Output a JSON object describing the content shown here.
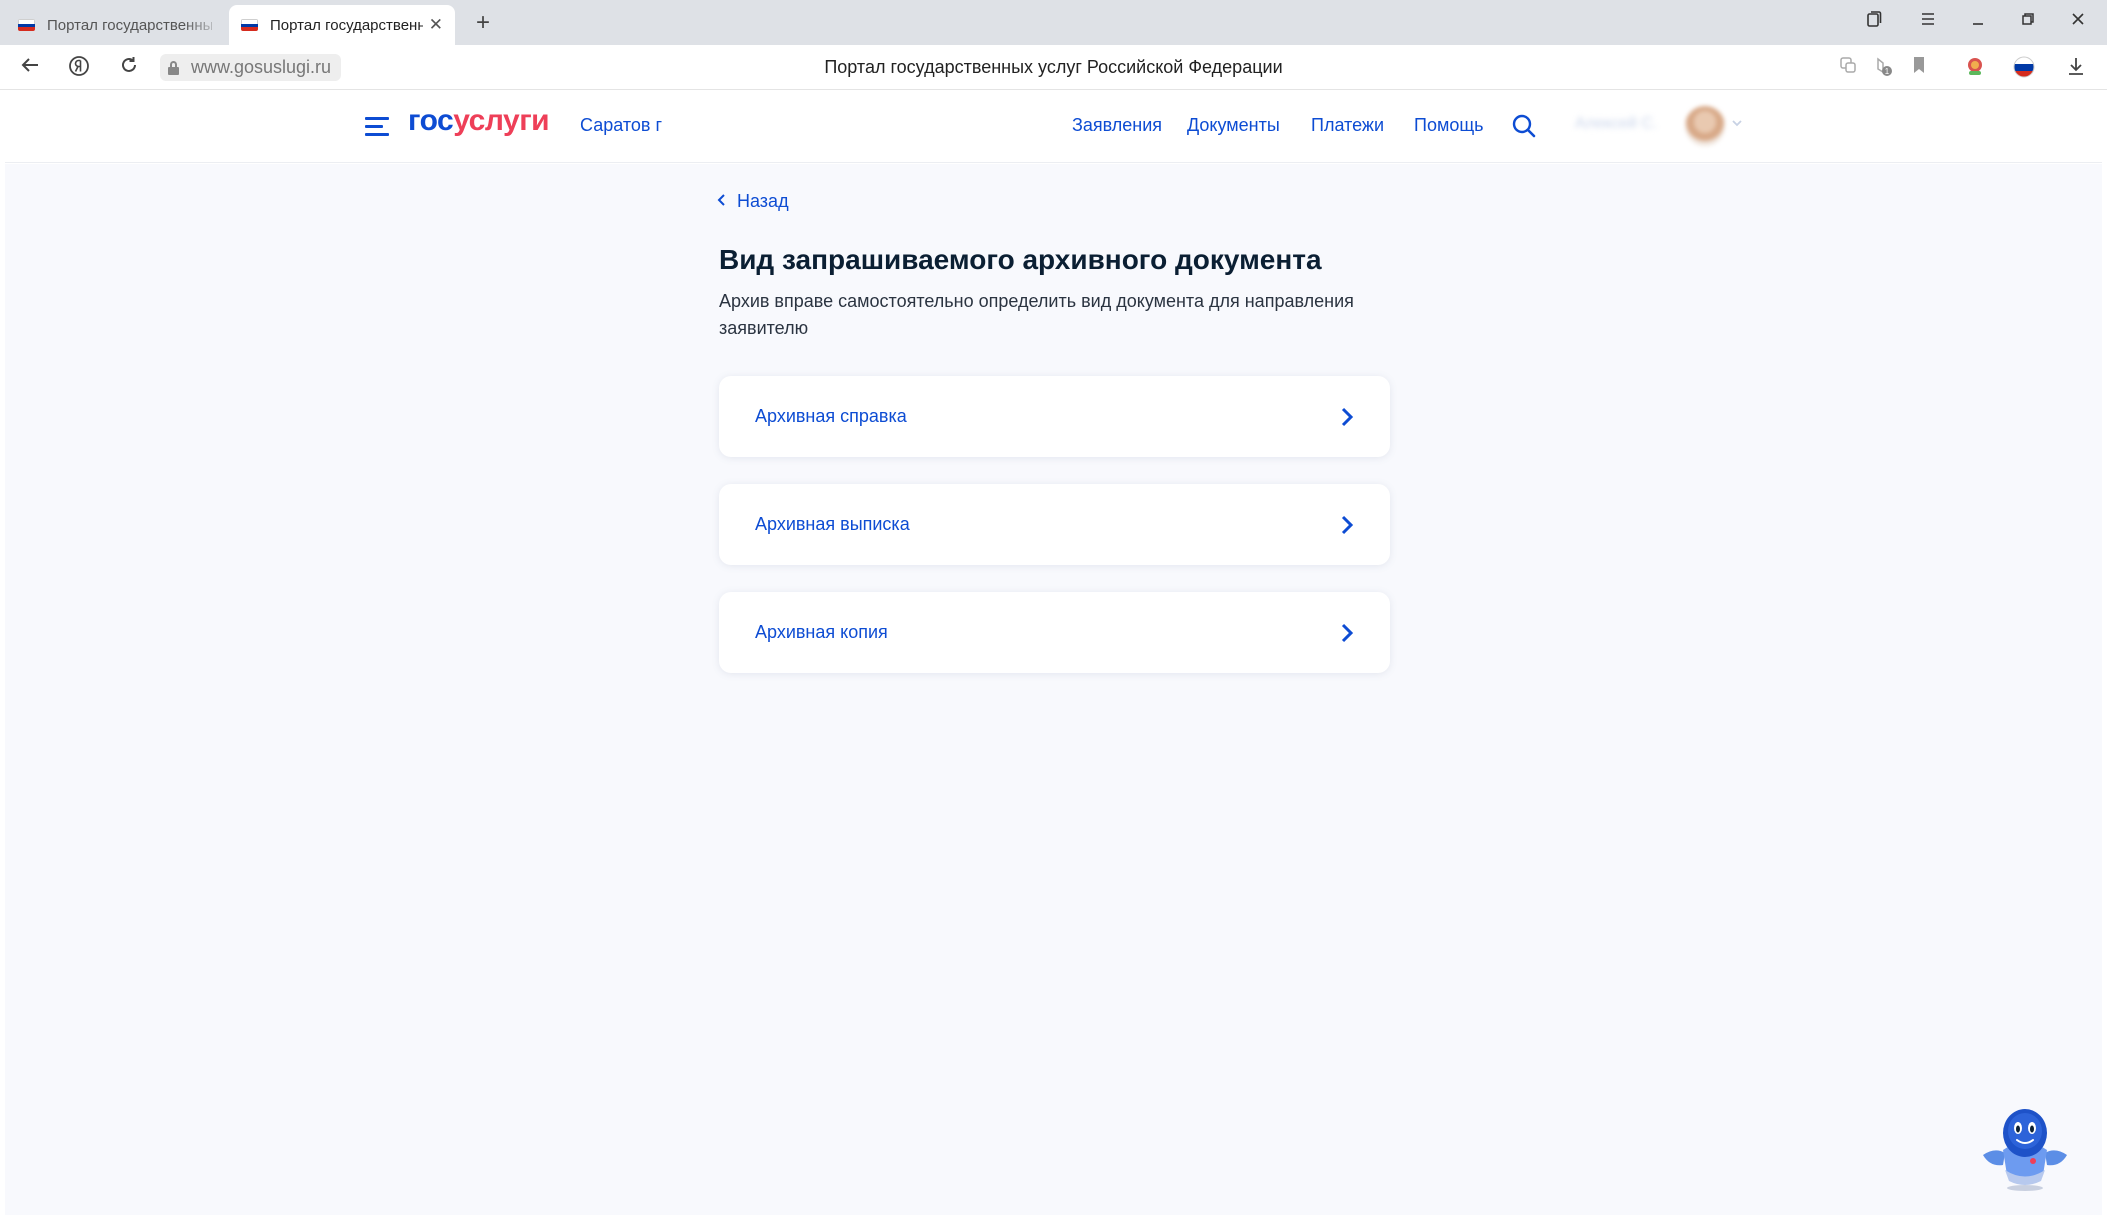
{
  "browser": {
    "tabs": [
      {
        "title": "Портал государственных"
      },
      {
        "title": "Портал государственны",
        "close": "✕"
      }
    ],
    "new_tab": "+",
    "url": "www.gosuslugi.ru",
    "window_title": "Портал государственных услуг Российской Федерации"
  },
  "header": {
    "logo_gos": "гос",
    "logo_uslugi": "услуги",
    "region": "Саратов г",
    "nav": [
      "Заявления",
      "Документы",
      "Платежи",
      "Помощь"
    ],
    "user_name": "Алексей С."
  },
  "main": {
    "back_label": "Назад",
    "title": "Вид запрашиваемого архивного документа",
    "description": "Архив вправе самостоятельно определить вид документа для направления заявителю",
    "options": [
      {
        "label": "Архивная справка"
      },
      {
        "label": "Архивная выписка"
      },
      {
        "label": "Архивная копия"
      }
    ]
  },
  "colors": {
    "brand_blue": "#0d4cd3",
    "brand_red": "#ee3f58",
    "page_bg": "#f8f9fd",
    "heading": "#0b1f33"
  },
  "icons": [
    "flag-ru-icon",
    "close-icon",
    "plus-icon",
    "back-arrow-icon",
    "yandex-icon",
    "reload-icon",
    "lock-icon",
    "bookmark-icon",
    "download-icon",
    "burger-icon",
    "search-icon",
    "chevron-left-icon",
    "chevron-right-icon",
    "robot-assistant-icon"
  ]
}
